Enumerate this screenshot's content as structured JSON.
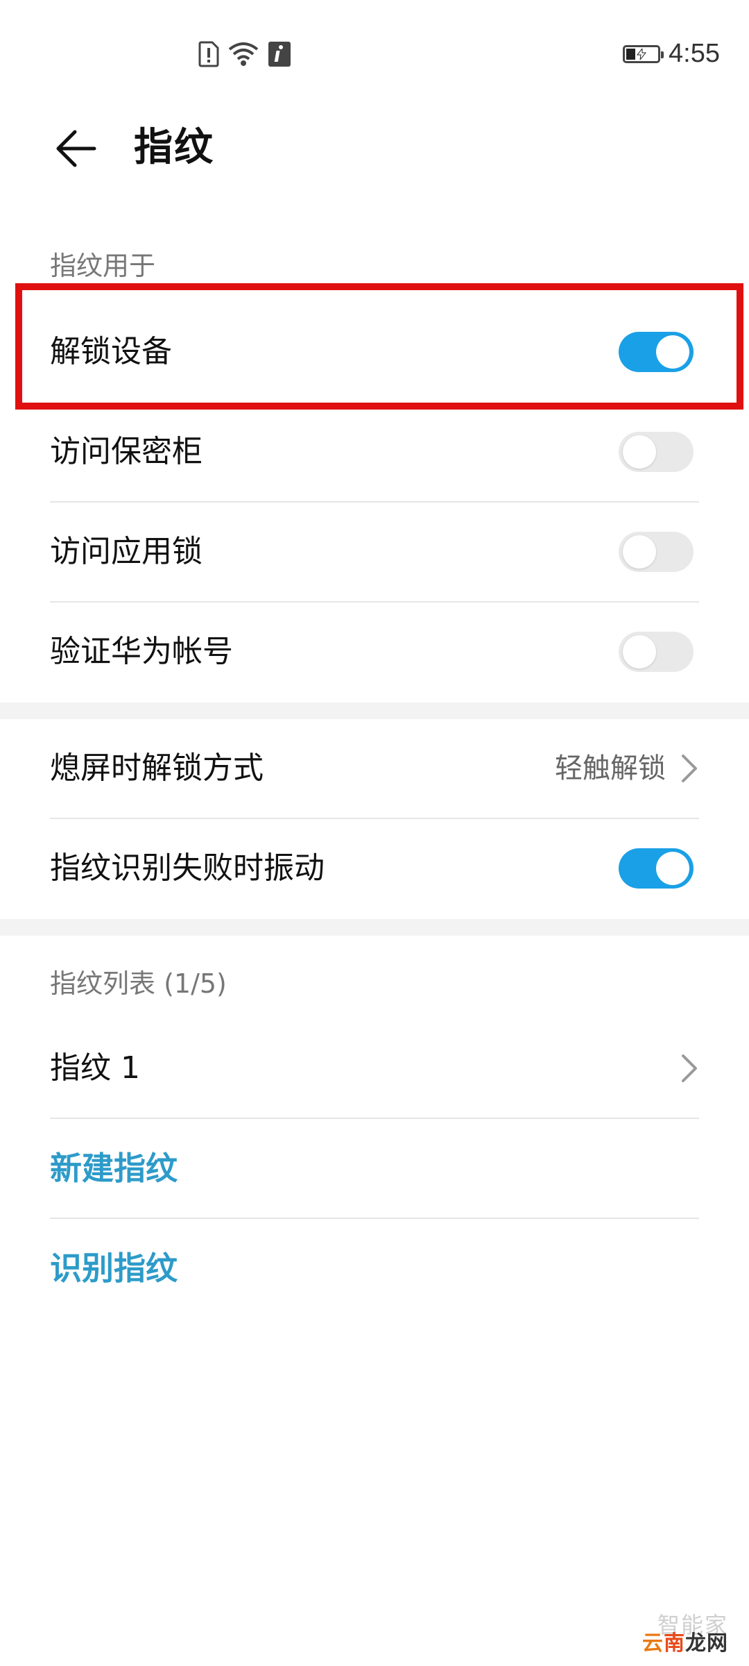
{
  "status_bar": {
    "time": "4:55",
    "icons": [
      "sim-alert-icon",
      "wifi-icon",
      "info-icon",
      "battery-charging-icon"
    ],
    "battery_level": 0.3
  },
  "header": {
    "title": "指纹",
    "back_icon": "arrow-left-icon"
  },
  "section_usage": {
    "label": "指纹用于",
    "items": [
      {
        "label": "解锁设备",
        "enabled": true
      },
      {
        "label": "访问保密柜",
        "enabled": false
      },
      {
        "label": "访问应用锁",
        "enabled": false
      },
      {
        "label": "验证华为帐号",
        "enabled": false
      }
    ]
  },
  "section_settings": {
    "screen_off": {
      "label": "熄屏时解锁方式",
      "value": "轻触解锁"
    },
    "vibrate": {
      "label": "指纹识别失败时振动",
      "enabled": true
    }
  },
  "section_list": {
    "label": "指纹列表 (1/5)",
    "items": [
      {
        "label": "指纹 1"
      }
    ],
    "actions": {
      "new": "新建指纹",
      "identify": "识别指纹"
    }
  },
  "watermark": {
    "line1": "智能家",
    "line2a": "云",
    "line2b": "南",
    "line2c": "龙网"
  },
  "colors": {
    "accent": "#1aa0e6",
    "link": "#2d9bc9",
    "highlight": "#e01010"
  }
}
